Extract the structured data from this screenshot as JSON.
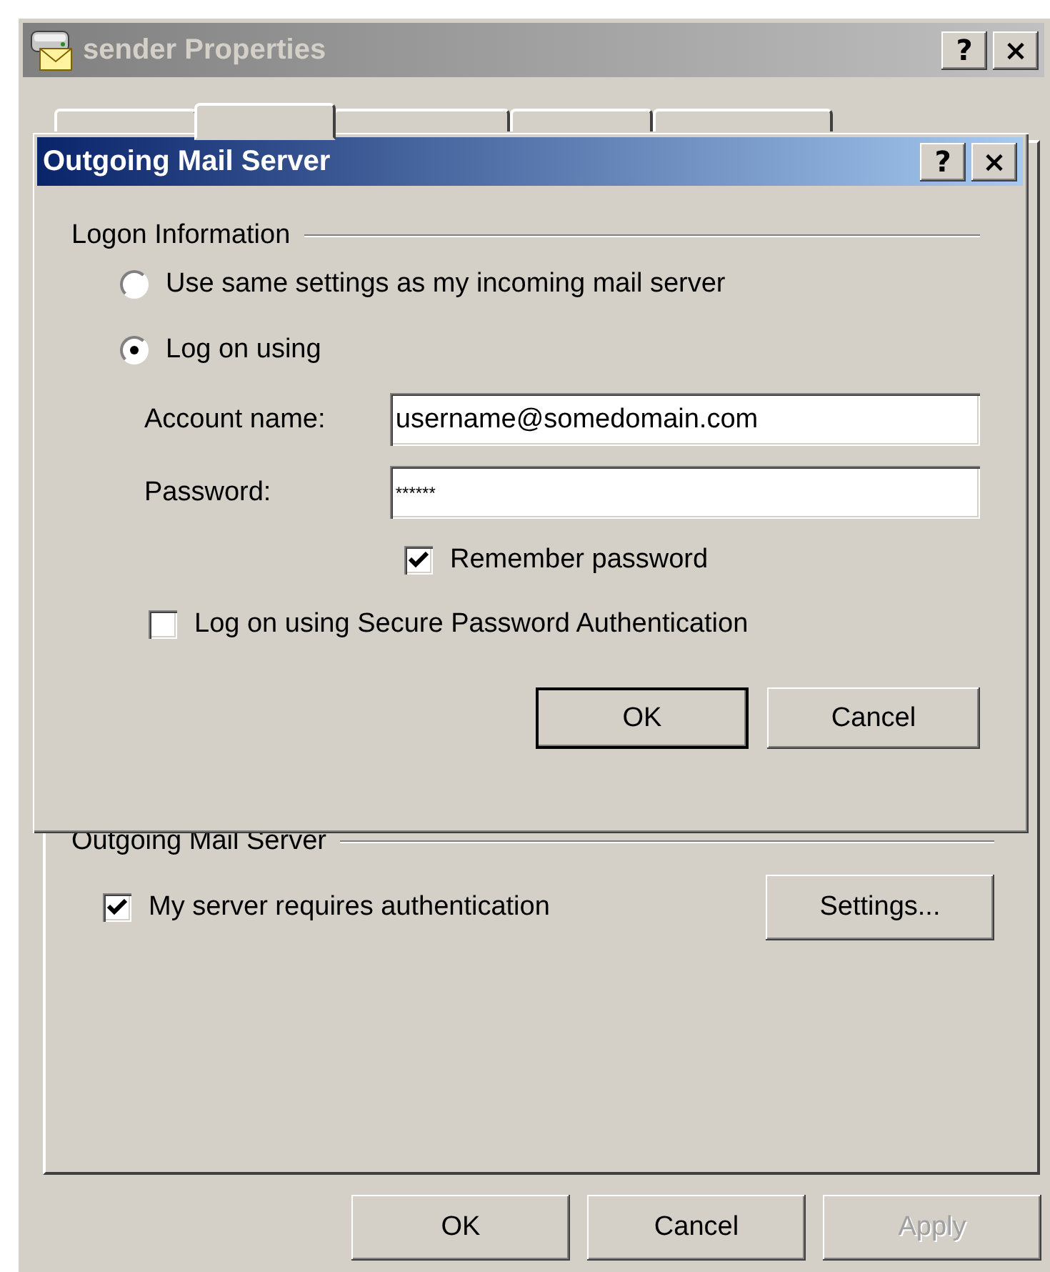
{
  "back_window": {
    "title": "sender Properties",
    "active": false,
    "title_buttons": [
      "?",
      "×"
    ],
    "tabs": [
      {
        "selected": false
      },
      {
        "selected": true
      },
      {
        "selected": false
      },
      {
        "selected": false
      },
      {
        "selected": false
      }
    ],
    "outgoing_group": {
      "label": "Outgoing Mail Server",
      "auth_checkbox": {
        "label": "My server requires authentication",
        "checked": true
      },
      "settings_button": "Settings..."
    },
    "buttons": [
      {
        "label": "OK",
        "disabled": false
      },
      {
        "label": "Cancel",
        "disabled": false
      },
      {
        "label": "Apply",
        "disabled": true
      }
    ]
  },
  "dialog": {
    "title": "Outgoing Mail Server",
    "active": true,
    "title_buttons": [
      "?",
      "×"
    ],
    "logon_group": {
      "label": "Logon Information",
      "options": [
        {
          "label": "Use same settings as my incoming mail server",
          "selected": false
        },
        {
          "label": "Log on using",
          "selected": true
        }
      ],
      "account_name": {
        "label": "Account name:",
        "value": "username@somedomain.com"
      },
      "password": {
        "label": "Password:",
        "value": "******"
      },
      "remember_password": {
        "label": "Remember password",
        "checked": true
      },
      "spa": {
        "label": "Log on using Secure Password Authentication",
        "checked": false
      }
    },
    "buttons": [
      {
        "label": "OK",
        "default": true
      },
      {
        "label": "Cancel",
        "default": false
      }
    ]
  }
}
